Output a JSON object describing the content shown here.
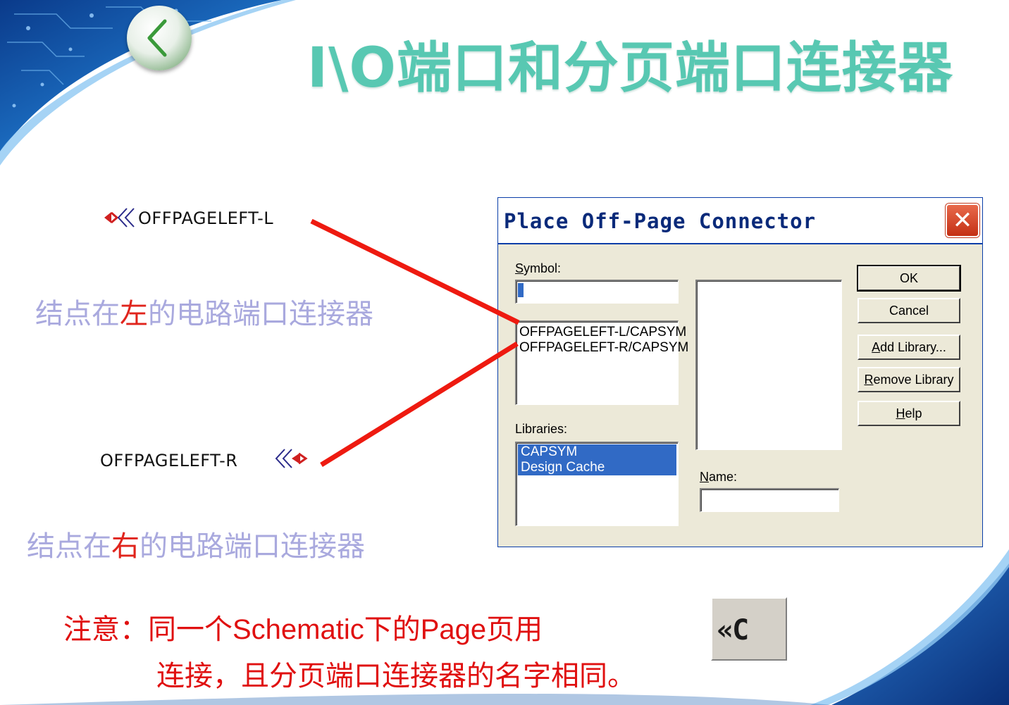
{
  "slide": {
    "title": "I\\O端口和分页端口连接器",
    "back_icon": "chevron-left-icon",
    "colors": {
      "title": "#58c8b2",
      "annotation": "#a9a9de",
      "highlight": "#e0241c",
      "connector_line": "#ee1a10"
    }
  },
  "symbols": {
    "left_label": "OFFPAGELEFT-L",
    "right_label": "OFFPAGELEFT-R",
    "left_desc_pre": "结点在",
    "left_desc_hl": "左",
    "left_desc_post": "的电路端口连接器",
    "right_desc_pre": "结点在",
    "right_desc_hl": "右",
    "right_desc_post": "的电路端口连接器"
  },
  "dialog": {
    "title": "Place Off-Page Connector",
    "symbol_label": "Symbol:",
    "symbol_value": "",
    "symbol_list": [
      "OFFPAGELEFT-L/CAPSYM",
      "OFFPAGELEFT-R/CAPSYM"
    ],
    "libraries_label": "Libraries:",
    "libraries": [
      "CAPSYM",
      "Design Cache"
    ],
    "name_label": "Name:",
    "name_value": "",
    "buttons": {
      "ok": "OK",
      "cancel": "Cancel",
      "add_library": "Add Library...",
      "remove_library": "Remove Library",
      "help": "Help"
    }
  },
  "note": {
    "line1_a": "注意：同一个",
    "line1_b": "Schematic",
    "line1_c": "下的",
    "line1_d": "Page",
    "line1_e": "页用",
    "line2": "连接，且分页端口连接器的名字相同。"
  },
  "toolbar_button": {
    "label": "«C",
    "icon": "place-offpage-connector-icon"
  }
}
